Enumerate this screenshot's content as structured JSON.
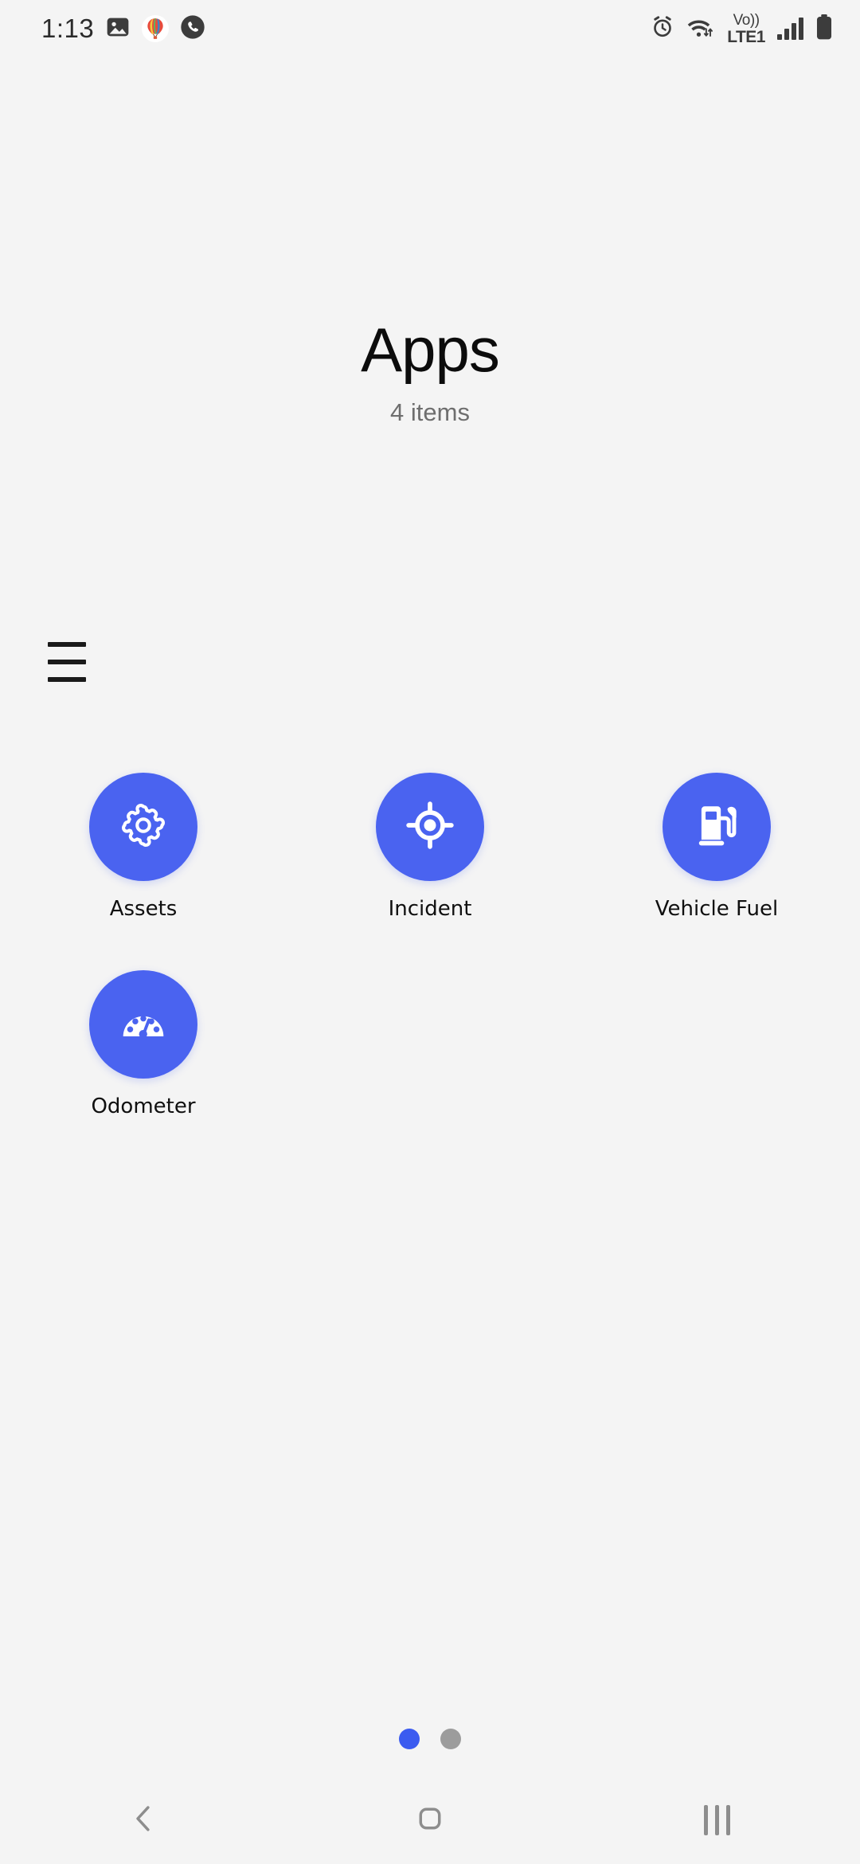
{
  "status_bar": {
    "time": "1:13",
    "left_icons": [
      {
        "name": "gallery-icon",
        "label": "Gallery"
      },
      {
        "name": "hot-air-balloon-icon",
        "label": "Balloon"
      },
      {
        "name": "phone-icon",
        "label": "Phone"
      }
    ],
    "right_icons": [
      {
        "name": "alarm-icon",
        "label": "Alarm"
      },
      {
        "name": "wifi-icon",
        "label": "Wi-Fi"
      },
      {
        "name": "volte-icon",
        "label": "VoLTE"
      },
      {
        "name": "signal-icon",
        "label": "Signal"
      },
      {
        "name": "battery-icon",
        "label": "Battery"
      }
    ],
    "volte_top": "Vo))",
    "volte_bottom": "LTE1"
  },
  "header": {
    "title": "Apps",
    "subtitle": "4 items"
  },
  "menu": {
    "hamburger_label": "Menu"
  },
  "apps": [
    {
      "label": "Assets",
      "icon": "gear-icon"
    },
    {
      "label": "Incident",
      "icon": "crosshair-target-icon"
    },
    {
      "label": "Vehicle Fuel",
      "icon": "fuel-pump-icon"
    },
    {
      "label": "Odometer",
      "icon": "speedometer-icon"
    }
  ],
  "pagination": {
    "total_pages": 2,
    "current_page": 1,
    "dots": [
      {
        "state": "active"
      },
      {
        "state": "inactive"
      }
    ]
  },
  "nav_bar": {
    "back_label": "Back",
    "home_label": "Home",
    "recents_label": "Recents"
  },
  "colors": {
    "accent": "#4a63f0",
    "background": "#f4f4f4",
    "dot_active": "#3b5bf0",
    "dot_inactive": "#9c9c9c",
    "text_primary": "#0c0c0c",
    "text_secondary": "#6e6e6e"
  }
}
